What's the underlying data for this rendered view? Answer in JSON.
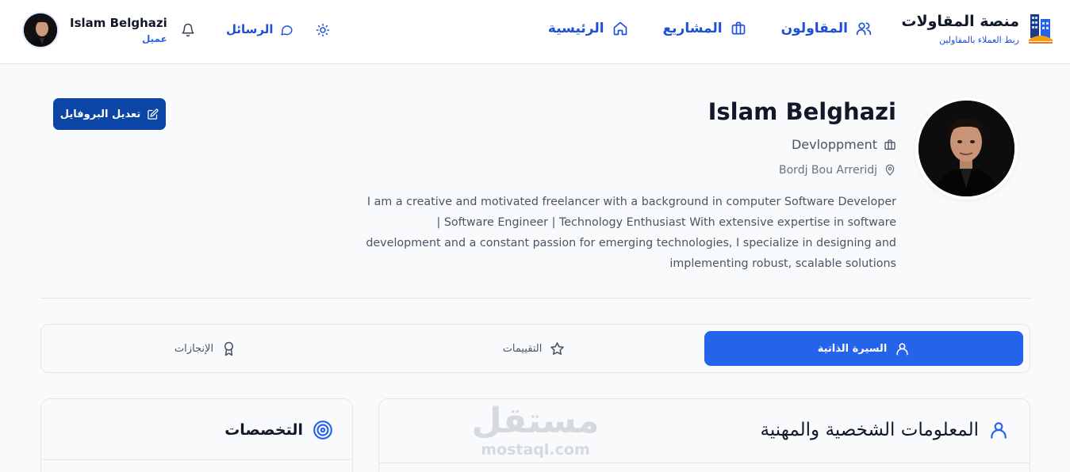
{
  "brand": {
    "title": "منصة المقاولات",
    "subtitle": "ربط العملاء بالمقاولين",
    "logo_icon": "building-logo-icon"
  },
  "nav": [
    {
      "label": "الرئيسية",
      "icon": "home-icon"
    },
    {
      "label": "المشاريع",
      "icon": "briefcase-icon"
    },
    {
      "label": "المقاولون",
      "icon": "users-icon"
    }
  ],
  "header": {
    "messages_label": "الرسائل",
    "user_name": "Islam Belghazi",
    "user_role": "عميل"
  },
  "profile": {
    "name": "Islam Belghazi",
    "job": "Devloppment",
    "location": "Bordj Bou Arreridj",
    "bio": "I am a creative and motivated freelancer with a background in computer Software Developer | Software Engineer | Technology Enthusiast With extensive expertise in software development and a constant passion for emerging technologies, I specialize in designing and implementing robust, scalable solutions",
    "edit_label": "تعديل البروفايل"
  },
  "tabs": [
    {
      "label": "السيرة الذاتية",
      "icon": "user-icon",
      "active": true
    },
    {
      "label": "التقييمات",
      "icon": "star-icon",
      "active": false
    },
    {
      "label": "الإنجازات",
      "icon": "award-icon",
      "active": false
    }
  ],
  "cards": {
    "info_title": "المعلومات الشخصية والمهنية",
    "specialties_title": "التخصصات"
  },
  "watermark": {
    "arabic": "مستقل",
    "latin": "mostaql.com"
  },
  "colors": {
    "primary": "#2563eb",
    "primary_dark": "#0b45a5",
    "nav_text": "#1e4fd8"
  }
}
